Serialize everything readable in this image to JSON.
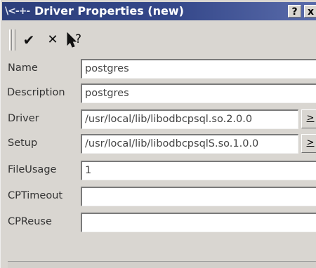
{
  "window": {
    "title": "Driver Properties (new)",
    "title_icon": "\\<-+-",
    "help_button": "?",
    "close_button": "x"
  },
  "toolbar": {
    "ok_icon": "✔",
    "cancel_icon": "✕",
    "whats_this_icon": "?"
  },
  "fields": [
    {
      "label": "Name",
      "value": "postgres"
    },
    {
      "label": "Description",
      "value": "postgres"
    },
    {
      "label": "Driver",
      "value": "/usr/local/lib/libodbcpsql.so.2.0.0",
      "button": ">"
    },
    {
      "label": "Setup",
      "value": "/usr/local/lib/libodbcpsqlS.so.1.0.0",
      "button": ">"
    },
    {
      "label": "FileUsage",
      "value": "1"
    },
    {
      "label": "CPTimeout",
      "value": ""
    },
    {
      "label": "CPReuse",
      "value": ""
    }
  ]
}
